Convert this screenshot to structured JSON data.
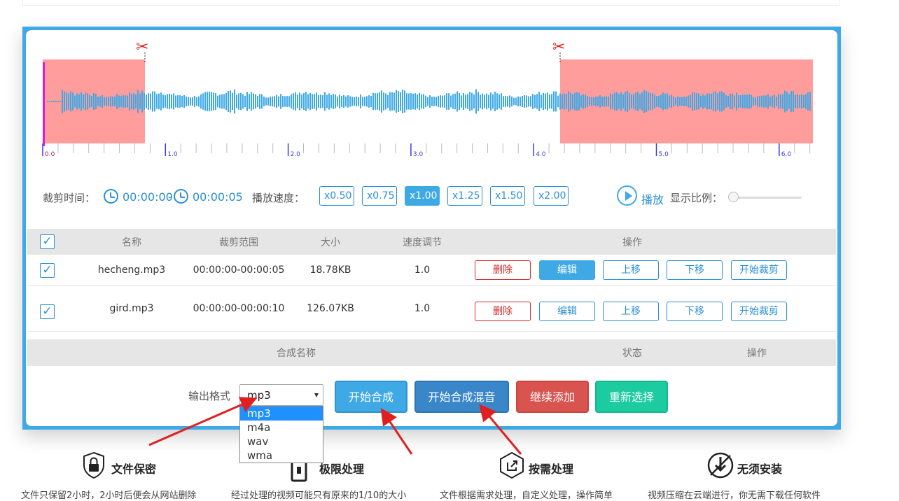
{
  "waveform": {
    "ticks": [
      "0.0",
      "1.0",
      "2.0",
      "3.0",
      "4.0",
      "5.0",
      "6.0"
    ],
    "wave_color": "#3fa9e6",
    "mask_color": "#ff9c9c",
    "playhead_color": "#d41ed4",
    "cut_marker_icon": "scissors-icon"
  },
  "controls": {
    "trim_label": "裁剪时间：",
    "start_time": "00:00:00",
    "separator": "-",
    "end_time": "00:00:05",
    "speed_label": "播放速度：",
    "speeds": [
      "x0.50",
      "x0.75",
      "x1.00",
      "x1.25",
      "x1.50",
      "x2.00"
    ],
    "active_speed": "x1.00",
    "play_label": "播放",
    "zoom_label": "显示比例："
  },
  "file_table": {
    "headers": {
      "check": "✓",
      "name": "名称",
      "range": "裁剪范围",
      "size": "大小",
      "speed": "速度调节",
      "ops": "操作"
    },
    "rows": [
      {
        "name": "hecheng.mp3",
        "range": "00:00:00-00:00:05",
        "size": "18.78KB",
        "speed": "1.0"
      },
      {
        "name": "gird.mp3",
        "range": "00:00:00-00:00:10",
        "size": "126.07KB",
        "speed": "1.0"
      }
    ],
    "actions": {
      "delete": "删除",
      "edit": "编辑",
      "up": "上移",
      "down": "下移",
      "trim": "开始裁剪"
    }
  },
  "mix_table": {
    "headers": {
      "name": "合成名称",
      "status": "状态",
      "ops": "操作"
    }
  },
  "output": {
    "format_label": "输出格式",
    "selected_format": "mp3",
    "format_options": [
      "mp3",
      "m4a",
      "wav",
      "wma"
    ],
    "buttons": {
      "merge": "开始合成",
      "mix": "开始合成混音",
      "add": "继续添加",
      "reselect": "重新选择"
    }
  },
  "features": [
    {
      "title": "文件保密",
      "icon": "lock-icon",
      "desc": "文件只保留2小时，2小时后便会从网站删除"
    },
    {
      "title": "极限处理",
      "icon": "file-icon",
      "desc": "经过处理的视频可能只有原来的1/10的大小"
    },
    {
      "title": "按需处理",
      "icon": "share-icon",
      "desc": "文件根据需求处理，自定义处理，操作简单"
    },
    {
      "title": "无须安装",
      "icon": "download-icon",
      "desc": "视频压缩在云端进行，你无需下载任何软件"
    }
  ],
  "annotation_color": "#e02020"
}
